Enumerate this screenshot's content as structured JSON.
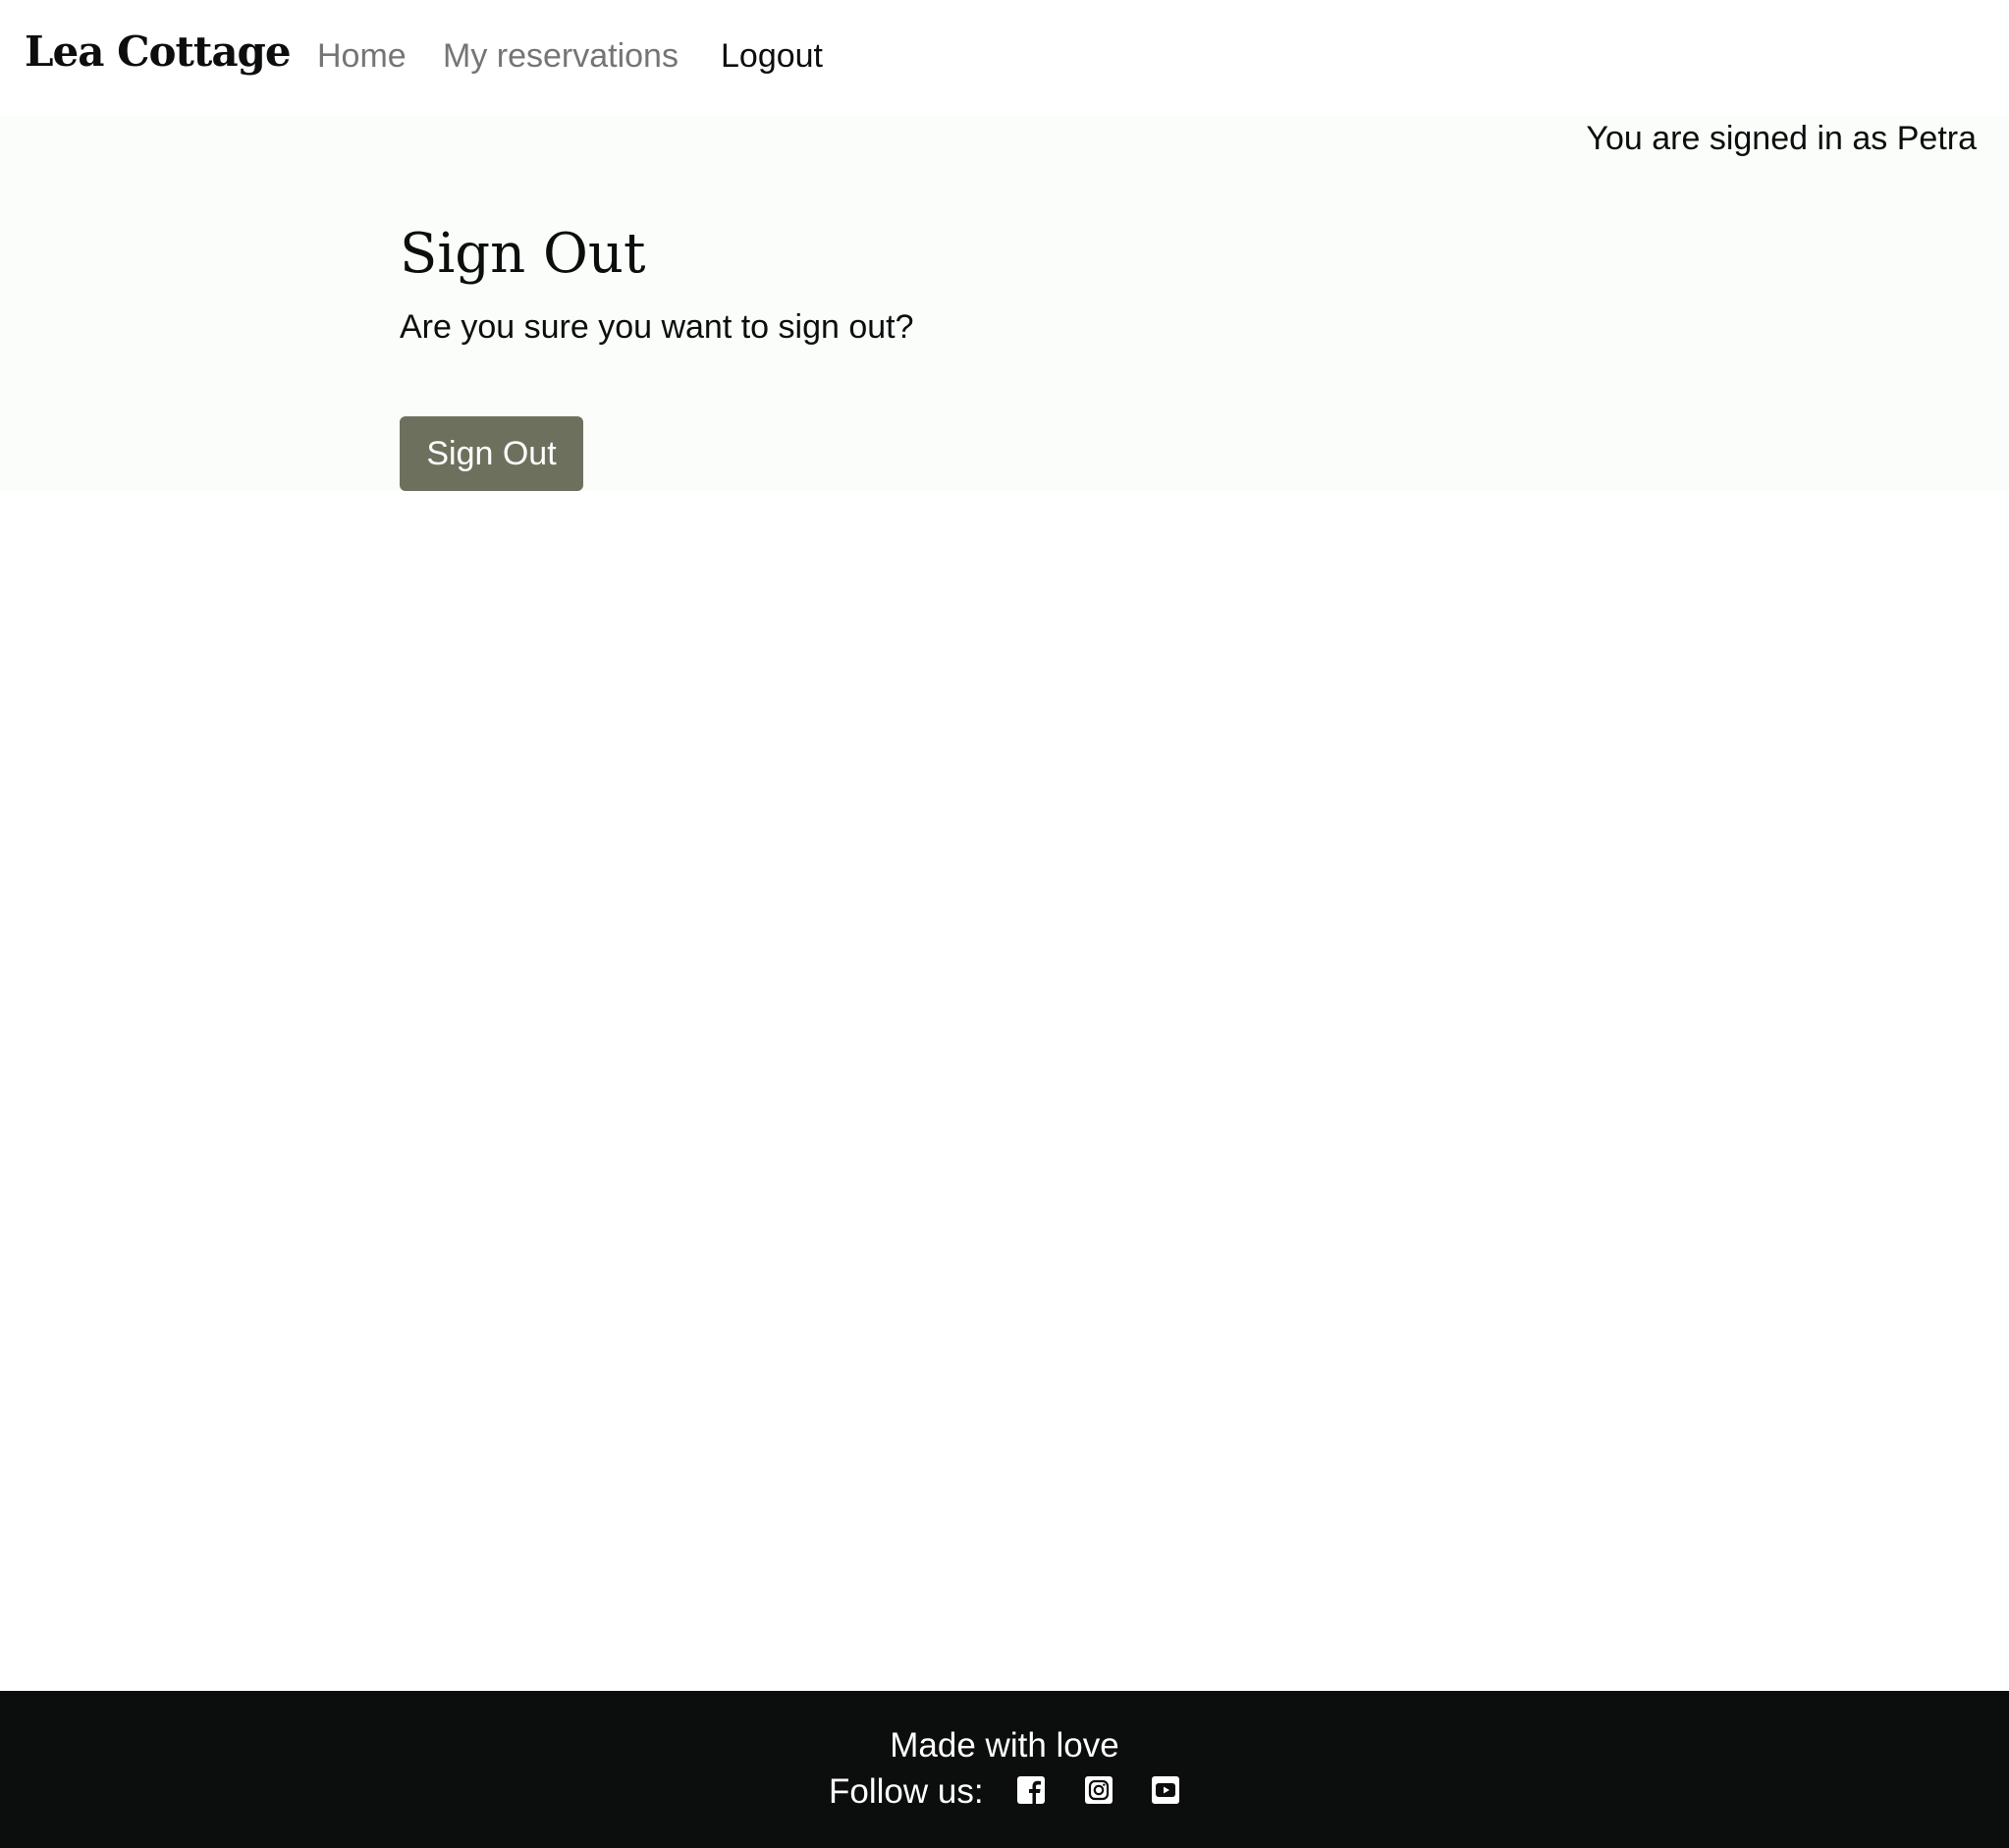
{
  "header": {
    "logo": "Lea Cottage",
    "nav": [
      {
        "label": "Home",
        "active": false
      },
      {
        "label": "My reservations",
        "active": false
      },
      {
        "label": "Logout",
        "active": true
      }
    ]
  },
  "status": {
    "signed_in_text": "You are signed in as Petra"
  },
  "main": {
    "title": "Sign Out",
    "message": "Are you sure you want to sign out?",
    "button_label": "Sign Out",
    "button_color": "#6e705e"
  },
  "footer": {
    "made_with": "Made with love",
    "follow_label": "Follow us:",
    "social_icons": [
      "facebook-icon",
      "instagram-icon",
      "youtube-icon"
    ]
  }
}
